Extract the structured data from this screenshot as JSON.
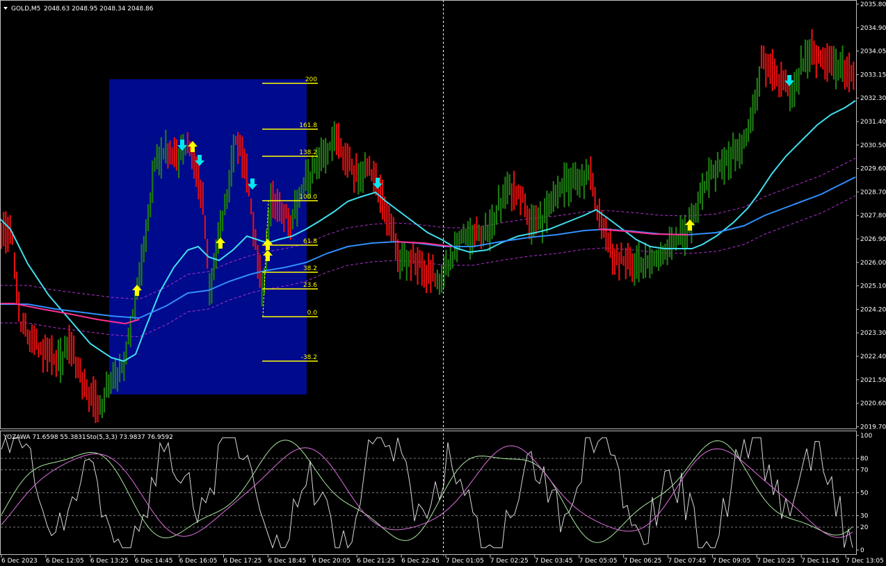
{
  "header": {
    "symbol": "GOLD,M5",
    "ohlc": "2048.63 2048.95 2048.34 2048.86"
  },
  "indicator": {
    "label": "YOZAWA 71.6598 55.3831",
    "sto_label": "Sto(5,3,3) 73.9837 76.9592"
  },
  "price_axis": {
    "labels": [
      "2035.80",
      "2034.90",
      "2034.05",
      "2033.15",
      "2032.30",
      "2031.40",
      "2030.50",
      "2029.60",
      "2028.70",
      "2027.80",
      "2026.90",
      "2026.00",
      "2025.10",
      "2024.20",
      "2023.30",
      "2022.40",
      "2021.50",
      "2020.60",
      "2019.70"
    ]
  },
  "osc_axis": {
    "labels": [
      "100",
      "80",
      "70",
      "50",
      "30",
      "20",
      "0"
    ]
  },
  "time_axis": {
    "labels": [
      "6 Dec 2023",
      "6 Dec 12:05",
      "6 Dec 13:25",
      "6 Dec 14:45",
      "6 Dec 16:05",
      "6 Dec 17:25",
      "6 Dec 18:45",
      "6 Dec 20:05",
      "6 Dec 21:25",
      "6 Dec 22:45",
      "7 Dec 01:05",
      "7 Dec 02:25",
      "7 Dec 03:45",
      "7 Dec 05:05",
      "7 Dec 06:25",
      "7 Dec 07:45",
      "7 Dec 09:05",
      "7 Dec 10:25",
      "7 Dec 11:45",
      "7 Dec 13:05"
    ]
  },
  "fibonacci": {
    "levels": [
      "200",
      "161.8",
      "138.2",
      "100.0",
      "61.8",
      "38.2",
      "23.6",
      "0.0",
      "-38.2"
    ]
  },
  "colors": {
    "background": "#000000",
    "bull": "#1e7a12",
    "bear": "#e01010",
    "fib_box": "#000a8c",
    "fib_line": "#ffff00",
    "ma_fast": "#40e0f0",
    "ma_slow": "#3090ff",
    "ma_trend": "#ff3090",
    "envelope": "#b030d0",
    "arrow_up": "#ffff00",
    "arrow_down": "#00e8f0"
  }
}
